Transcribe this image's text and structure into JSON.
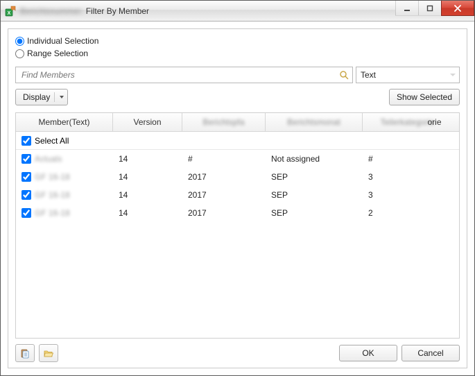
{
  "window": {
    "title_blur": "Berichtsnummer:",
    "title": "Filter By Member"
  },
  "mode": {
    "individual": "Individual Selection",
    "range": "Range Selection",
    "selected": "individual"
  },
  "search": {
    "placeholder": "Find Members",
    "type_label": "Text"
  },
  "toolbar": {
    "display_label": "Display",
    "show_selected_label": "Show Selected"
  },
  "table": {
    "headers": {
      "member": "Member(Text)",
      "version": "Version",
      "col3_blur": "Berichtspfa",
      "col4_blur": "Berichtsmonat",
      "col5_blur": "Teilerkategorie",
      "col5_suffix": "orie"
    },
    "select_all_label": "Select All",
    "rows": [
      {
        "checked": true,
        "member_blur": "Actuals",
        "version": "14",
        "c3": "#",
        "c4": "Not assigned",
        "c5": "#"
      },
      {
        "checked": true,
        "member_blur": "GF 16-18",
        "version": "14",
        "c3": "2017",
        "c4": "SEP",
        "c5": "3"
      },
      {
        "checked": true,
        "member_blur": "GF 16-18",
        "version": "14",
        "c3": "2017",
        "c4": "SEP",
        "c5": "3"
      },
      {
        "checked": true,
        "member_blur": "GF 16-18",
        "version": "14",
        "c3": "2017",
        "c4": "SEP",
        "c5": "2"
      }
    ]
  },
  "footer": {
    "ok_label": "OK",
    "cancel_label": "Cancel"
  }
}
